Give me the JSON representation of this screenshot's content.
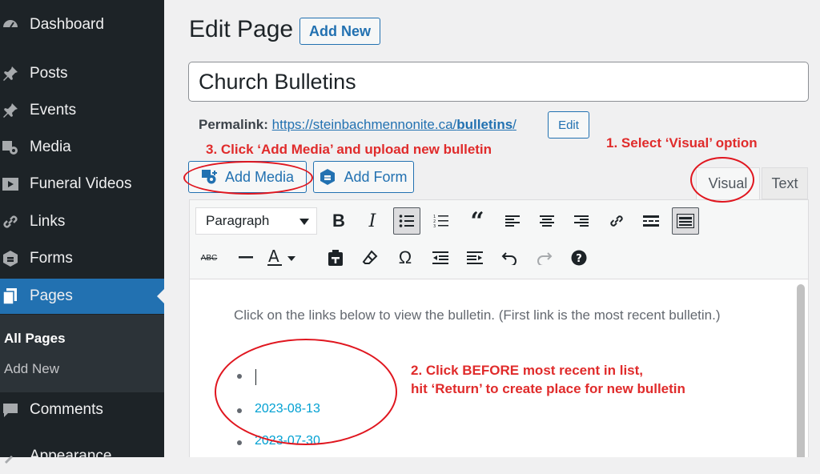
{
  "sidebar": {
    "items": [
      {
        "icon": "dashboard-icon",
        "label": "Dashboard"
      },
      {
        "icon": "pushpin-icon",
        "label": "Posts"
      },
      {
        "icon": "pushpin-icon",
        "label": "Events"
      },
      {
        "icon": "media-icon",
        "label": "Media"
      },
      {
        "icon": "video-icon",
        "label": "Funeral Videos"
      },
      {
        "icon": "links-icon",
        "label": "Links"
      },
      {
        "icon": "forms-icon",
        "label": "Forms"
      },
      {
        "icon": "pages-icon",
        "label": "Pages"
      },
      {
        "icon": "comments-icon",
        "label": "Comments"
      },
      {
        "icon": "appearance-icon",
        "label": "Appearance"
      }
    ],
    "submenu": [
      "All Pages",
      "Add New"
    ],
    "colors": {
      "bg": "#1d2327",
      "active": "#2271b1"
    }
  },
  "page": {
    "heading": "Edit Page",
    "add_new_label": "Add New",
    "title_value": "Church Bulletins"
  },
  "permalink": {
    "label": "Permalink:",
    "url_base": "https://steinbachmennonite.ca/",
    "slug": "bulletins",
    "slash": "/",
    "edit_label": "Edit"
  },
  "media_buttons": {
    "add_media": "Add Media",
    "add_form": "Add Form"
  },
  "tabs": {
    "visual": "Visual",
    "text": "Text",
    "active": "Visual"
  },
  "toolbar": {
    "format_value": "Paragraph",
    "row1": [
      "bold-icon",
      "italic-icon",
      "bullet-list-icon",
      "numbered-list-icon",
      "blockquote-icon",
      "align-left-icon",
      "align-center-icon",
      "align-right-icon",
      "link-icon",
      "read-more-icon",
      "toolbar-toggle-icon"
    ],
    "row2": [
      "strikethrough-icon",
      "horizontal-line-icon",
      "text-color-icon",
      "paste-text-icon",
      "clear-formatting-icon",
      "special-character-icon",
      "outdent-icon",
      "indent-icon",
      "undo-icon",
      "redo-icon",
      "help-icon"
    ]
  },
  "content": {
    "intro": "Click on the links below to view the bulletin. (First link is the most recent bulletin.)",
    "list": [
      "",
      "2023-08-13",
      "2023-07-30"
    ]
  },
  "annotations": {
    "step1": "1. Select ‘Visual’ option",
    "step2_line1": "2. Click BEFORE most recent in list,",
    "step2_line2": "hit ‘Return’ to create place for new bulletin",
    "step3": "3. Click ‘Add Media’ and upload new bulletin",
    "color": "#e02b2b"
  }
}
